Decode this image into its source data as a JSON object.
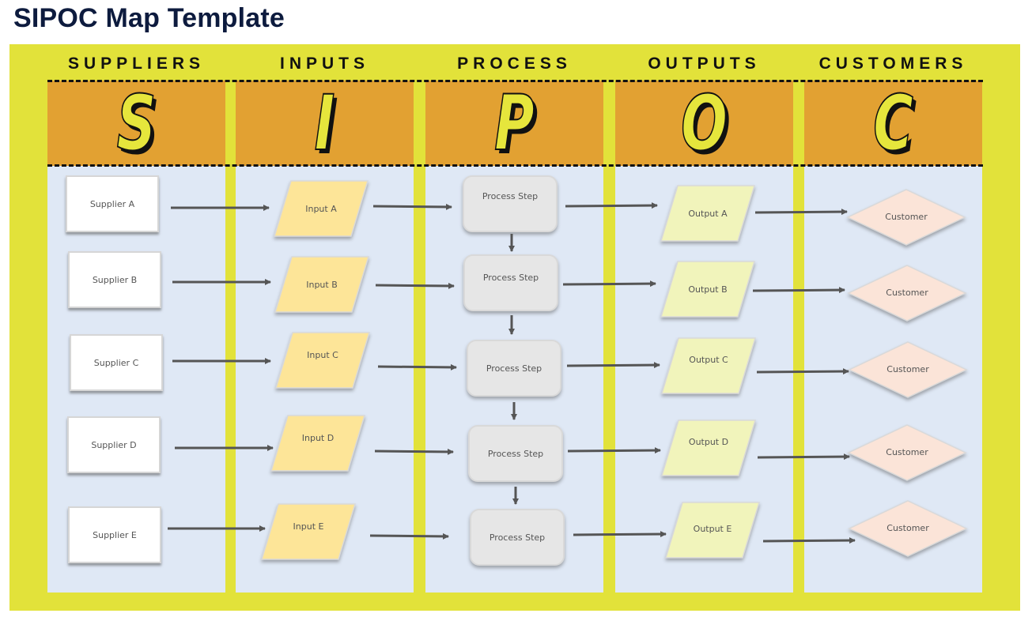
{
  "title": "SIPOC Map Template",
  "colors": {
    "frame": "#e2e23a",
    "header_band": "#e2a132",
    "panel": "#dfe8f5",
    "letter_fill": "#e6e63c",
    "title": "#0d1b3e",
    "input_fill": "#fde598",
    "output_fill": "#f1f4bb",
    "process_fill": "#e6e6e6",
    "customer_fill": "#fbe4d8",
    "arrow": "#555555"
  },
  "columns": [
    {
      "label": "SUPPLIERS",
      "letter": "S"
    },
    {
      "label": "INPUTS",
      "letter": "I"
    },
    {
      "label": "PROCESS",
      "letter": "P"
    },
    {
      "label": "OUTPUTS",
      "letter": "O"
    },
    {
      "label": "CUSTOMERS",
      "letter": "C"
    }
  ],
  "suppliers": [
    "Supplier A",
    "Supplier B",
    "Supplier C",
    "Supplier D",
    "Supplier E"
  ],
  "inputs": [
    "Input A",
    "Input B",
    "Input C",
    "Input D",
    "Input E"
  ],
  "process_steps": [
    "Process Step",
    "Process Step",
    "Process Step",
    "Process Step",
    "Process Step"
  ],
  "outputs": [
    "Output A",
    "Output B",
    "Output C",
    "Output D",
    "Output E"
  ],
  "customers": [
    "Customer",
    "Customer",
    "Customer",
    "Customer",
    "Customer"
  ]
}
